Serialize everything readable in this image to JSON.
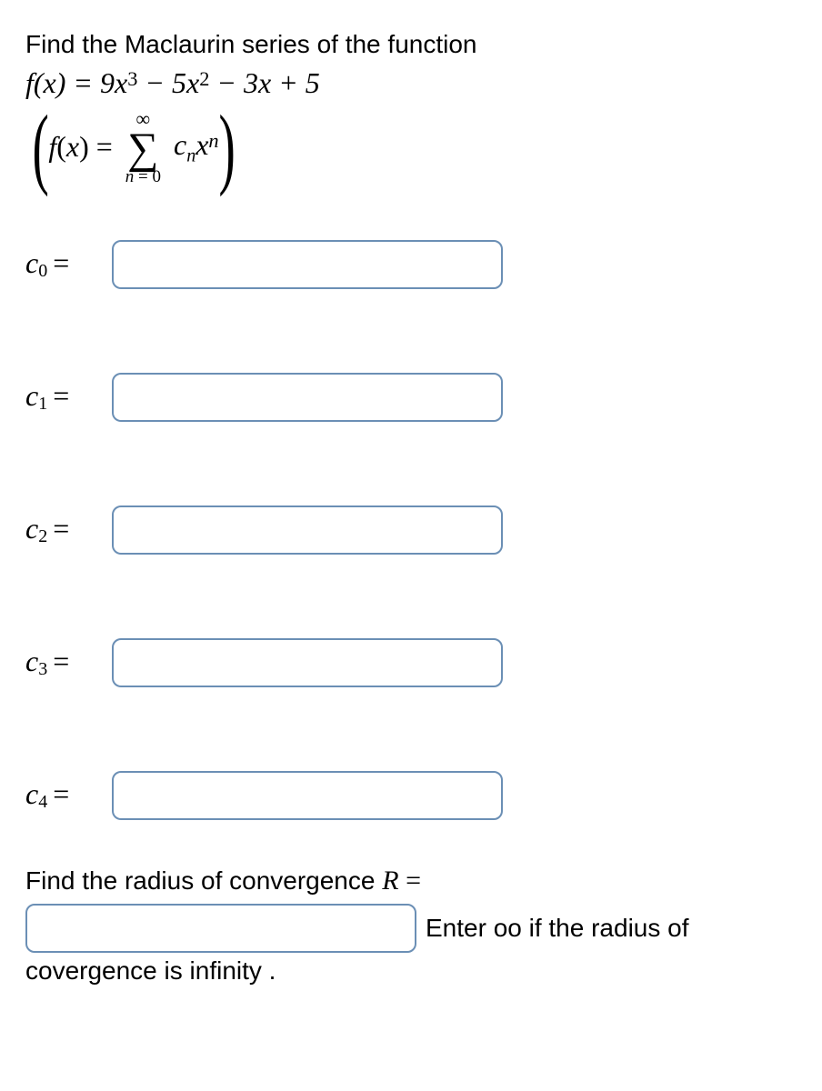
{
  "prompt": "Find the Maclaurin series of the function",
  "function_display": "f(x) = 9x³ − 5x² − 3x + 5",
  "series_display_left": "f(x) =",
  "series_display_right": "cₙxⁿ",
  "sigma_top": "∞",
  "sigma_bottom_var": "n",
  "sigma_bottom_eq": "= 0",
  "coefficients": [
    {
      "label_base": "c",
      "label_sub": "0",
      "eq": "="
    },
    {
      "label_base": "c",
      "label_sub": "1",
      "eq": "="
    },
    {
      "label_base": "c",
      "label_sub": "2",
      "eq": "="
    },
    {
      "label_base": "c",
      "label_sub": "3",
      "eq": "="
    },
    {
      "label_base": "c",
      "label_sub": "4",
      "eq": "="
    }
  ],
  "roc_prompt_pre": "Find the radius of convergence ",
  "roc_prompt_math": "R =",
  "roc_after_text": "Enter oo if the radius of",
  "roc_trailing": "covergence is infinity ."
}
